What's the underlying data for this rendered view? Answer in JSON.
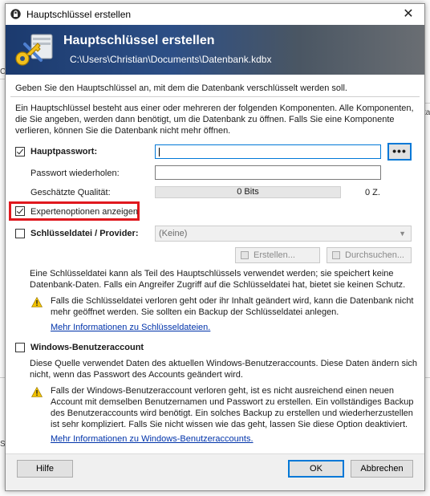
{
  "background": {
    "frag1": "C",
    "frag2": "ta",
    "frag3": "Sl"
  },
  "window": {
    "title": "Hauptschlüssel erstellen",
    "close_glyph": "✕"
  },
  "banner": {
    "title": "Hauptschlüssel erstellen",
    "path": "C:\\Users\\Christian\\Documents\\Datenbank.kdbx"
  },
  "intro": {
    "line1": "Geben Sie den Hauptschlüssel an, mit dem die Datenbank verschlüsselt werden soll.",
    "desc1": "Ein Hauptschlüssel besteht aus einer oder mehreren der folgenden Komponenten. Alle Komponenten,",
    "desc2": "die Sie angeben, werden dann benötigt, um die Datenbank zu öffnen. Falls Sie eine Komponente",
    "desc3": "verlieren, können Sie die Datenbank nicht mehr öffnen."
  },
  "password": {
    "label": "Hauptpasswort:",
    "checked": true,
    "value": "",
    "toggle_label": "•••",
    "repeat_label": "Passwort wiederholen:",
    "repeat_value": "",
    "quality_label": "Geschätzte Qualität:",
    "quality_bits": "0 Bits",
    "quality_chars": "0 Z."
  },
  "expert": {
    "label": "Expertenoptionen anzeigen",
    "checked": true
  },
  "keyfile": {
    "label": "Schlüsseldatei / Provider:",
    "checked": false,
    "selected": "(Keine)",
    "create_label": "Erstellen...",
    "browse_label": "Durchsuchen...",
    "desc1": "Eine Schlüsseldatei kann als Teil des Hauptschlüssels verwendet werden; sie speichert keine",
    "desc2": "Datenbank-Daten. Falls ein Angreifer Zugriff auf die Schlüsseldatei hat, bietet sie keinen Schutz.",
    "warn1": "Falls die Schlüsseldatei verloren geht oder ihr Inhalt geändert wird, kann die Datenbank nicht",
    "warn2": "mehr geöffnet werden. Sie sollten ein Backup der Schlüsseldatei anlegen.",
    "link": "Mehr Informationen zu Schlüsseldateien."
  },
  "winaccount": {
    "label": "Windows-Benutzeraccount",
    "checked": false,
    "desc1": "Diese Quelle verwendet Daten des aktuellen Windows-Benutzeraccounts. Diese Daten ändern sich",
    "desc2": "nicht, wenn das Passwort des Accounts geändert wird.",
    "warn1": "Falls der Windows-Benutzeraccount verloren geht, ist es nicht ausreichend einen neuen",
    "warn2": "Account mit demselben Benutzernamen und Passwort zu erstellen. Ein vollständiges Backup",
    "warn3": "des Benutzeraccounts wird benötigt. Ein solches Backup zu erstellen und wiederherzustellen",
    "warn4": "ist sehr kompliziert. Falls Sie nicht wissen wie das geht, lassen Sie diese Option deaktiviert.",
    "link": "Mehr Informationen zu Windows-Benutzeraccounts."
  },
  "footer": {
    "help_label": "Hilfe",
    "ok_label": "OK",
    "cancel_label": "Abbrechen"
  },
  "colors": {
    "highlight": "#e0181e",
    "accent": "#0078d7",
    "link": "#0033aa",
    "warning": "#f2c200"
  },
  "icons": {
    "title": "lock-icon",
    "banner": "key-icon",
    "warning": "warning-icon",
    "close": "close-icon"
  }
}
